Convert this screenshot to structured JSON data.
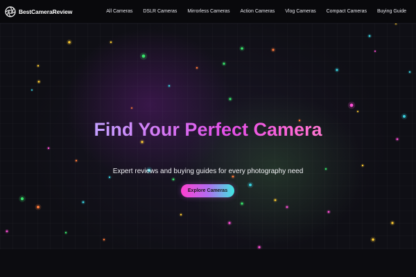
{
  "brand": {
    "name": "BestCameraReview",
    "logo_icon": "camera-aperture-icon"
  },
  "nav": {
    "items": [
      {
        "label": "All Cameras"
      },
      {
        "label": "DSLR Cameras"
      },
      {
        "label": "Mirrorless Cameras"
      },
      {
        "label": "Action Cameras"
      },
      {
        "label": "Vlog Cameras"
      },
      {
        "label": "Compact Cameras"
      },
      {
        "label": "Buying Guide"
      }
    ]
  },
  "hero": {
    "title": "Find Your Perfect Camera",
    "subtitle": "Expert reviews and buying guides for every photography need",
    "cta_label": "Explore Cameras"
  },
  "colors": {
    "background": "#0b0b10",
    "header": "#09090c",
    "title_gradient": [
      "#a9b6ff",
      "#e44fe8",
      "#ffb3c8"
    ],
    "cta_gradient": [
      "#ff3fd0",
      "#b26cf0",
      "#3ee6e0"
    ],
    "particle_colors": [
      "#39e36a",
      "#ff4fd8",
      "#ffcc33",
      "#3ad0e0",
      "#ff7a3a"
    ]
  }
}
